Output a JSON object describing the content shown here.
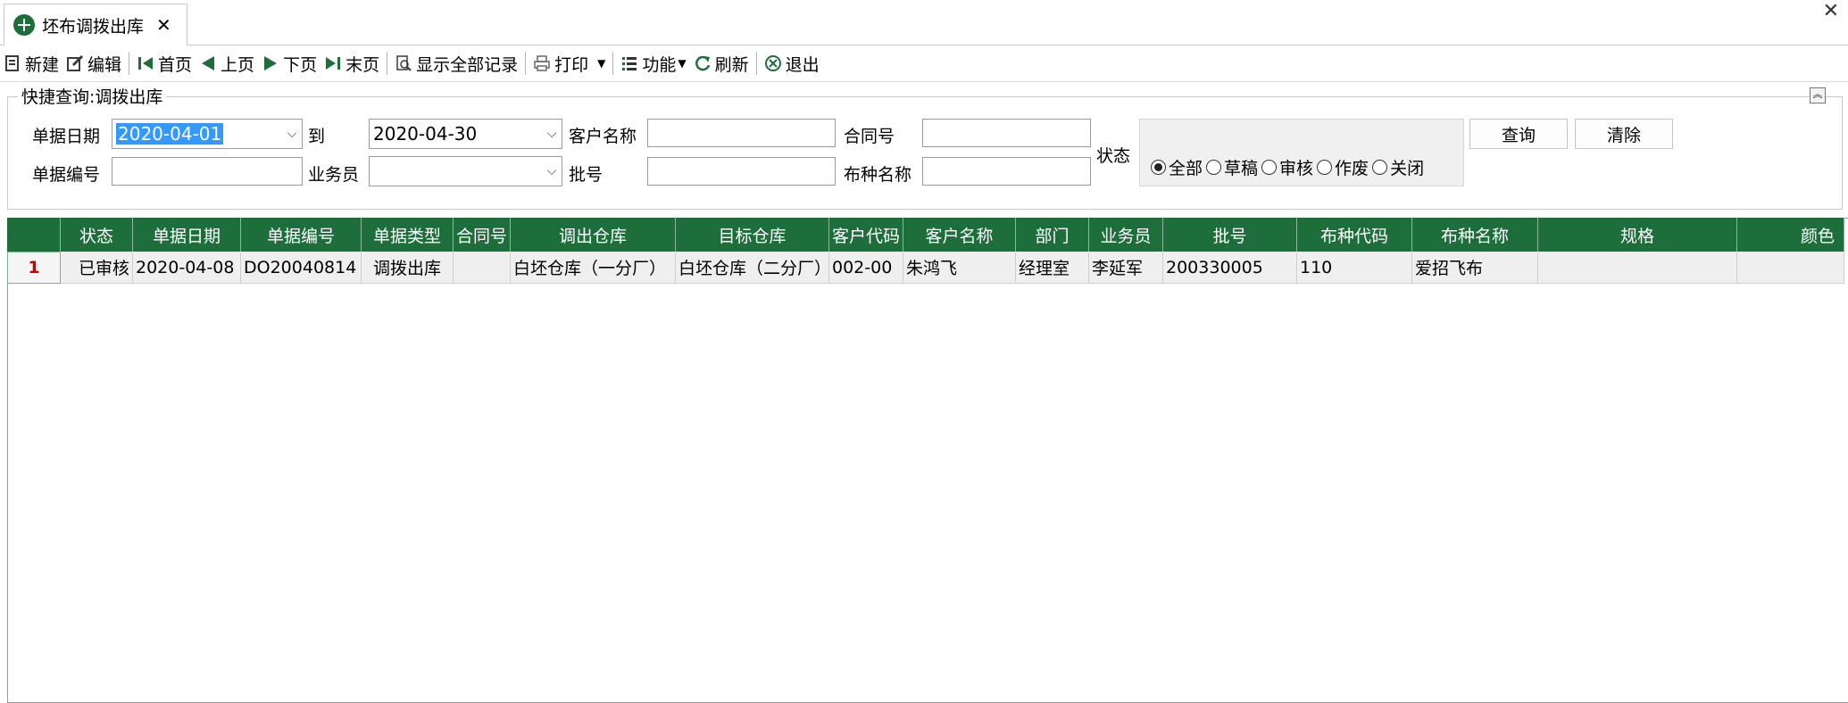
{
  "tab": {
    "title": "坯布调拨出库",
    "close": "✕"
  },
  "window_close": "✕",
  "toolbar": {
    "new": "新建",
    "edit": "编辑",
    "first": "首页",
    "prev": "上页",
    "next": "下页",
    "last": "末页",
    "show_all": "显示全部记录",
    "print": "打印",
    "function": "功能",
    "refresh": "刷新",
    "exit": "退出"
  },
  "query": {
    "title": "快捷查询:调拨出库",
    "date_label": "单据日期",
    "date_from": "2020-04-01",
    "to_label": "到",
    "date_to": "2020-04-30",
    "customer_label": "客户名称",
    "customer_value": "",
    "contract_label": "合同号",
    "contract_value": "",
    "docno_label": "单据编号",
    "docno_value": "",
    "salesman_label": "业务员",
    "salesman_value": "",
    "batch_label": "批号",
    "batch_value": "",
    "fabric_label": "布种名称",
    "fabric_value": "",
    "status_label": "状态",
    "status_options": [
      "全部",
      "草稿",
      "审核",
      "作废",
      "关闭"
    ],
    "status_selected": "全部",
    "search_button": "查询",
    "clear_button": "清除"
  },
  "grid": {
    "columns": [
      "",
      "状态",
      "单据日期",
      "单据编号",
      "单据类型",
      "合同号",
      "调出仓库",
      "目标仓库",
      "客户代码",
      "客户名称",
      "部门",
      "业务员",
      "批号",
      "布种代码",
      "布种名称",
      "规格",
      "颜色"
    ],
    "rows": [
      [
        "1",
        "已审核",
        "2020-04-08",
        "DO20040814",
        "调拨出库",
        "",
        "白坯仓库（一分厂）",
        "白坯仓库（二分厂）",
        "002-00",
        "朱鸿飞",
        "经理室",
        "李延军",
        "200330005",
        "110",
        "爱招飞布",
        "",
        ""
      ]
    ]
  },
  "colors": {
    "header_bg": "#1e6e3c",
    "row_bg": "#efefef",
    "selection": "#3399ff"
  }
}
